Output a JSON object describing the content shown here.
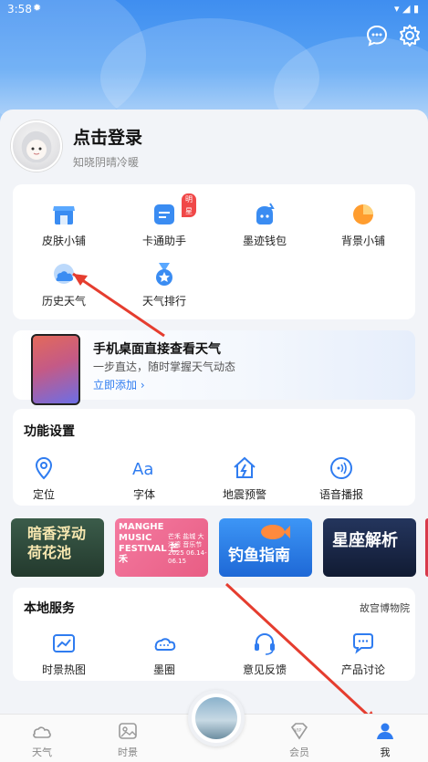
{
  "status_bar": {
    "time": "3:58"
  },
  "profile": {
    "login_label": "点击登录",
    "subtitle": "知晓阴晴冷暖"
  },
  "quick_grid": [
    {
      "label": "皮肤小铺",
      "icon": "shop-icon"
    },
    {
      "label": "卡通助手",
      "icon": "assistant-icon",
      "badge": "明星"
    },
    {
      "label": "墨迹钱包",
      "icon": "wallet-icon"
    },
    {
      "label": "背景小铺",
      "icon": "background-icon"
    },
    {
      "label": "历史天气",
      "icon": "history-weather-icon"
    },
    {
      "label": "天气排行",
      "icon": "ranking-icon"
    }
  ],
  "promo": {
    "title": "手机桌面直接查看天气",
    "subtitle": "一步直达，随时掌握天气动态",
    "link": "立即添加 ›"
  },
  "settings": {
    "title": "功能设置",
    "items": [
      {
        "label": "定位",
        "icon": "location-icon"
      },
      {
        "label": "字体",
        "icon": "font-icon"
      },
      {
        "label": "地震预警",
        "icon": "earthquake-icon"
      },
      {
        "label": "语音播报",
        "icon": "voice-icon"
      }
    ]
  },
  "banners": [
    {
      "text": "暗香浮动 荷花池",
      "color": "#2e4a3a"
    },
    {
      "text": "MANGHE MUSIC FESTIVAL 芒禾",
      "sub": "芒禾 盐城 大洋湾 音乐节 2025 06.14-06.15",
      "color": "#ee6a8c"
    },
    {
      "text": "钓鱼指南",
      "color": "#2a7fe8"
    },
    {
      "text": "星座解析",
      "color": "#1b2a4c"
    }
  ],
  "local": {
    "title": "本地服务",
    "link": "故宫博物院",
    "items": [
      {
        "label": "时景热图",
        "icon": "heatmap-icon"
      },
      {
        "label": "墨圈",
        "icon": "cloud-circle-icon"
      },
      {
        "label": "意见反馈",
        "icon": "headset-icon"
      },
      {
        "label": "产品讨论",
        "icon": "chat-icon"
      }
    ]
  },
  "tabbar": [
    {
      "label": "天气",
      "icon": "weather-icon",
      "active": false
    },
    {
      "label": "时景",
      "icon": "photo-icon",
      "active": false
    },
    {
      "label": "会员",
      "icon": "vip-icon",
      "active": false
    },
    {
      "label": "我",
      "icon": "person-icon",
      "active": true
    }
  ],
  "colors": {
    "accent": "#2f7cf0",
    "arrow": "#e53d2f",
    "badge": "#f04848"
  }
}
